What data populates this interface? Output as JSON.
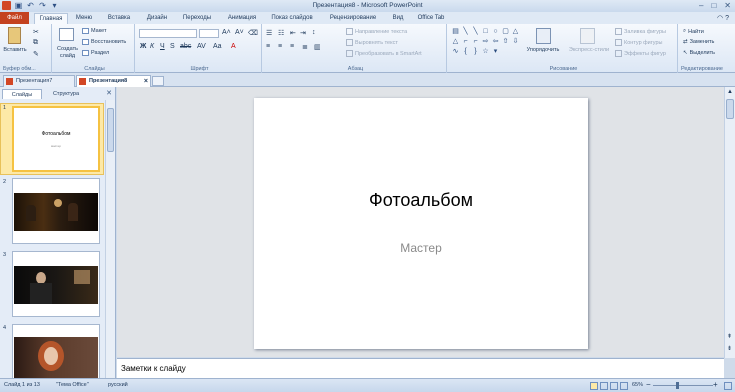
{
  "window": {
    "title": "Презентация8 - Microsoft PowerPoint",
    "minimize": "–",
    "maximize": "□",
    "close": "✕"
  },
  "ribbon_tabs": [
    "Файл",
    "Главная",
    "Меню",
    "Вставка",
    "Дизайн",
    "Переходы",
    "Анимация",
    "Показ слайдов",
    "Рецензирование",
    "Вид",
    "Office Tab"
  ],
  "ribbon": {
    "clipboard": {
      "paste": "Вставить",
      "label": "Буфер обм..."
    },
    "slides": {
      "new_slide": "Создать слайд",
      "layout": "Макет",
      "reset": "Восстановить",
      "section": "Раздел",
      "label": "Слайды"
    },
    "font": {
      "label": "Шрифт"
    },
    "paragraph": {
      "text_direction": "Направление текста",
      "align_text": "Выровнять текст",
      "smartart": "Преобразовать в SmartArt",
      "label": "Абзац"
    },
    "drawing": {
      "arrange": "Упорядочить",
      "quick_styles": "Экспресс-стили",
      "fill": "Заливка фигуры",
      "outline": "Контур фигуры",
      "effects": "Эффекты фигур",
      "label": "Рисование"
    },
    "editing": {
      "find": "Найти",
      "replace": "Заменить",
      "select": "Выделить",
      "label": "Редактирование"
    }
  },
  "doc_tabs": [
    {
      "label": "Презентация7",
      "active": false
    },
    {
      "label": "Презентация8",
      "active": true
    }
  ],
  "left_pane": {
    "tabs": [
      "Слайды",
      "Структура"
    ],
    "thumbs": [
      {
        "num": "1",
        "title": "Фотоальбом",
        "sub": "мастер"
      },
      {
        "num": "2"
      },
      {
        "num": "3"
      },
      {
        "num": "4"
      }
    ]
  },
  "slide": {
    "title": "Фотоальбом",
    "subtitle": "Мастер"
  },
  "notes": {
    "placeholder": "Заметки к слайду"
  },
  "status": {
    "slide_info": "Слайд 1 из 13",
    "theme": "\"Тема Office\"",
    "language": "русский",
    "zoom": "65%"
  },
  "colors": {
    "file_tab": "#c4421f",
    "ribbon_bg": "#dce7f5",
    "selected_thumb": "#f5c242"
  }
}
